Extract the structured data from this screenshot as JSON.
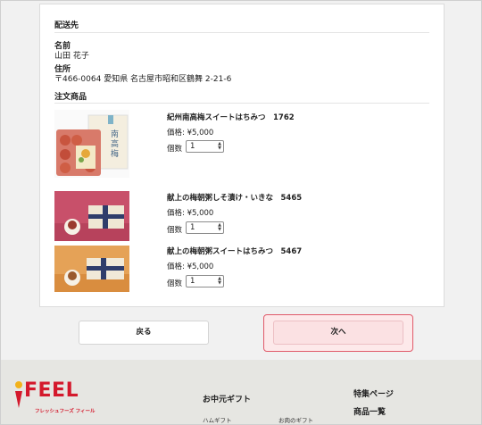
{
  "shipping": {
    "section_title": "配送先",
    "name_label": "名前",
    "name_value": "山田 花子",
    "address_label": "住所",
    "address_value": "〒466-0064 愛知県 名古屋市昭和区鶴舞 2-21-6"
  },
  "order": {
    "section_title": "注文商品",
    "items": [
      {
        "name": "紀州南高梅スイートはちみつ　1762",
        "price": "価格: ¥5,000",
        "qty_label": "個数",
        "qty": "1",
        "image": "product-pack-icon"
      },
      {
        "name": "献上の梅朝粥しそ漬け・いきな　5465",
        "price": "価格: ¥5,000",
        "qty_label": "個数",
        "qty": "1",
        "image": "gift-box-icon"
      },
      {
        "name": "献上の梅朝粥スイートはちみつ　5467",
        "price": "価格: ¥5,000",
        "qty_label": "個数",
        "qty": "1",
        "image": "gift-box-icon"
      }
    ]
  },
  "buttons": {
    "back": "戻る",
    "next": "次へ"
  },
  "footer": {
    "logo": "FEEL",
    "logo_sub": "フレッシュフーズ フィール",
    "col1_head": "お中元ギフト",
    "col1_links": [
      "ハムギフト",
      "お肉のギフト"
    ],
    "col2_head": "特集ページ",
    "col2_sub": "商品一覧"
  },
  "colors": {
    "accent_red": "#d4192c",
    "next_border": "#e05a6a",
    "footer_bg": "#e6e6e2"
  }
}
